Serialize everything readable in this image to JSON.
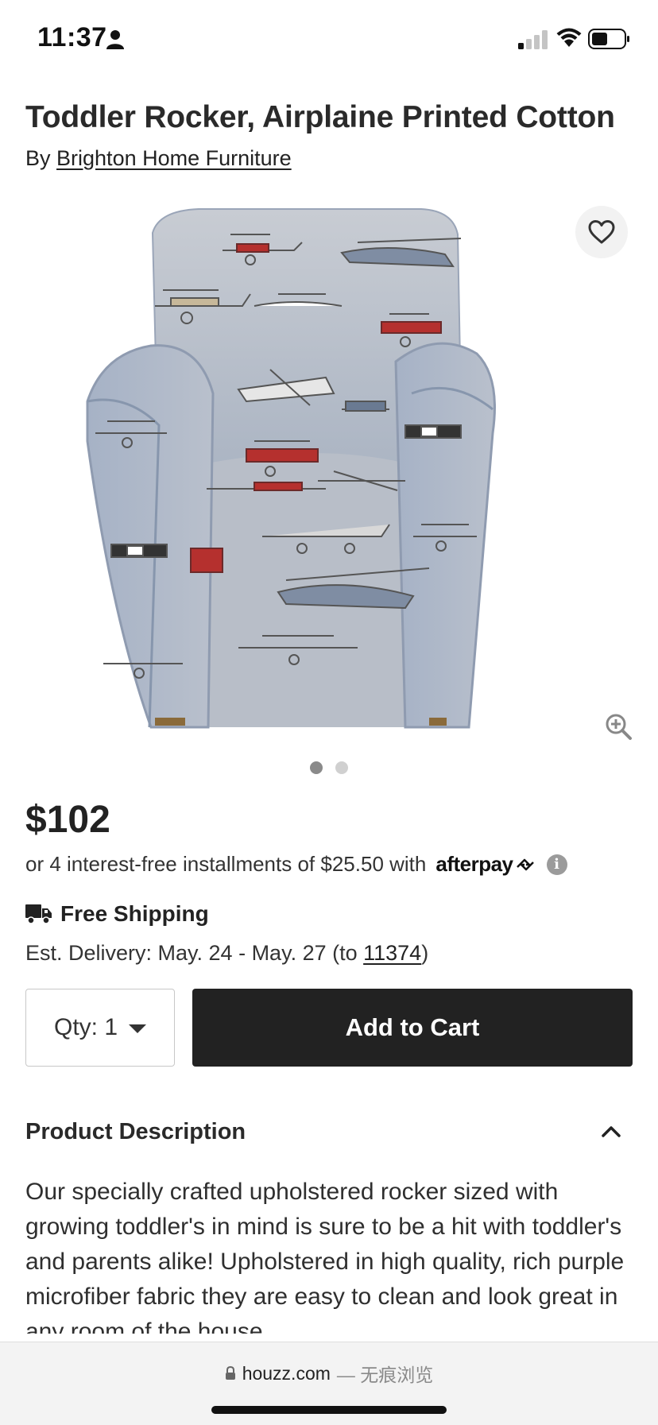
{
  "status": {
    "time": "11:37"
  },
  "product": {
    "title": "Toddler Rocker, Airplaine Printed Cotton",
    "by_prefix": "By",
    "brand": "Brighton Home Furniture",
    "price": "$102",
    "installments_text": "or 4 interest-free installments of $25.50 with",
    "afterpay_label": "afterpay",
    "info_glyph": "i",
    "shipping_label": "Free Shipping",
    "delivery_prefix": "Est. Delivery: May. 24 - May. 27 (to ",
    "delivery_zip": "11374",
    "delivery_suffix": ")",
    "qty_label": "Qty: 1",
    "add_to_cart_label": "Add to Cart",
    "description_heading": "Product Description",
    "description_text": "Our specially crafted upholstered rocker sized with growing toddler's in mind is sure to be a hit with toddler's and parents alike! Upholstered in high quality, rich purple microfiber fabric they are easy to clean and look great in any room of the house"
  },
  "gallery": {
    "image_count": 2,
    "active_index": 0
  },
  "browser": {
    "domain": "houzz.com",
    "mode_label": "— 无痕浏览"
  },
  "colors": {
    "button_bg": "#222222",
    "fabric": "#a9b4c4",
    "accent_red": "#b5302e"
  }
}
